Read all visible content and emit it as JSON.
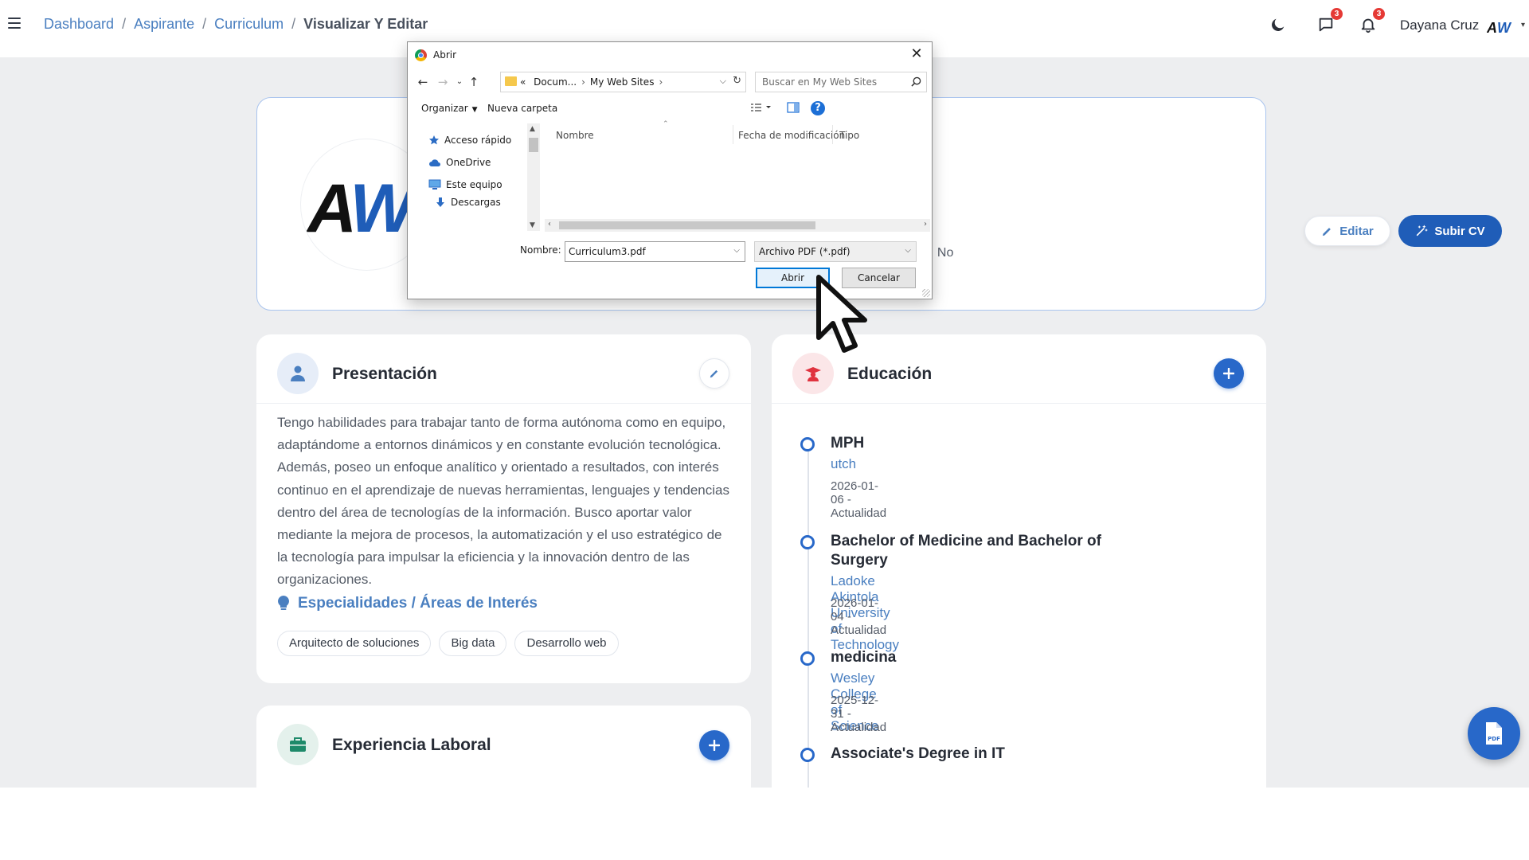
{
  "breadcrumb": {
    "items": [
      "Dashboard",
      "Aspirante",
      "Curriculum"
    ],
    "separator": "/",
    "current": "Visualizar Y Editar"
  },
  "topbar": {
    "theme_icon": "moon-icon",
    "messages_badge": "3",
    "notifications_badge": "3",
    "user_name": "Dayana Cruz",
    "avatar_text": "AW"
  },
  "profile": {
    "logo_text_dark": "A",
    "logo_text_blue": "W",
    "info_text": ": No",
    "edit_label": "Editar",
    "upload_label": "Subir CV"
  },
  "presentation": {
    "title": "Presentación",
    "text": "Tengo habilidades para trabajar tanto de forma autónoma como en equipo, adaptándome a entornos dinámicos y en constante evolución tecnológica. Además, poseo un enfoque analítico y orientado a resultados, con interés continuo en el aprendizaje de nuevas herramientas, lenguajes y tendencias dentro del área de tecnologías de la información. Busco aportar valor mediante la mejora de procesos, la automatización y el uso estratégico de la tecnología para impulsar la eficiencia y la innovación dentro de las organizaciones.",
    "specialties_title": "Especialidades / Áreas de Interés",
    "tags": [
      "Arquitecto de soluciones",
      "Big data",
      "Desarrollo web"
    ]
  },
  "experience": {
    "title": "Experiencia Laboral"
  },
  "education": {
    "title": "Educación",
    "items": [
      {
        "degree": "MPH",
        "school": "utch",
        "dates": "2026-01-06 - Actualidad"
      },
      {
        "degree": "Bachelor of Medicine and Bachelor of Surgery",
        "school": "Ladoke Akintola University of Technology",
        "dates": "2026-01-04 - Actualidad"
      },
      {
        "degree": "medicina",
        "school": "Wesley College of Science",
        "dates": "2025-12-31 - Actualidad"
      },
      {
        "degree": "Associate's Degree in IT",
        "school": "",
        "dates": ""
      }
    ]
  },
  "dialog": {
    "title": "Abrir",
    "path": {
      "prefix": "«",
      "parts": [
        "Docum...",
        "My Web Sites"
      ]
    },
    "search_placeholder": "Buscar en My Web Sites",
    "toolbar": {
      "organize": "Organizar",
      "new_folder": "Nueva carpeta"
    },
    "nav_items": [
      "Acceso rápido",
      "OneDrive",
      "Este equipo",
      "Descargas"
    ],
    "columns": [
      "Nombre",
      "Fecha de modificación",
      "Tipo"
    ],
    "filename_label": "Nombre:",
    "filename_value": "Curriculum3.pdf",
    "filetype": "Archivo PDF (*.pdf)",
    "open_label": "Abrir",
    "cancel_label": "Cancelar"
  },
  "colors": {
    "accent_blue": "#2868c9",
    "link_blue": "#4a7fc0",
    "education_icon_red": "#e0333f",
    "experience_icon_green": "#1e8a6a"
  }
}
